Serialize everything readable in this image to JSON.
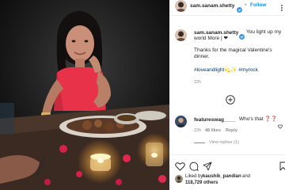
{
  "header": {
    "username": "sam.sanam.shetty",
    "separator": "•",
    "follow_label": "Follow"
  },
  "caption": {
    "username": "sam.sanam.shetty",
    "text_line1": "You light up my",
    "text_line2": "world More | ❤",
    "body_line1": "Thanks for the magical Valentine's",
    "body_line2": "dinner.",
    "hashtags": "#loveandlight💫✨ #myrock",
    "time": "22h"
  },
  "comment": {
    "username": "featureswag____",
    "text": "Who's that ❓❓",
    "time": "22h",
    "likes": "48 likes",
    "reply_label": "Reply",
    "view_replies": "View replies (1)"
  },
  "likes": {
    "prefix": "Liked by",
    "user": "kaushik_pandian",
    "and": "and",
    "count": "118,729 others"
  },
  "colors": {
    "follow_blue": "#0095f6",
    "verified_blue": "#3897f0",
    "hashtag_blue": "#00376b"
  },
  "icons": [
    "verified-icon",
    "more-icon",
    "add-comment-icon",
    "heart-icon",
    "comment-icon",
    "share-icon",
    "bookmark-icon"
  ]
}
